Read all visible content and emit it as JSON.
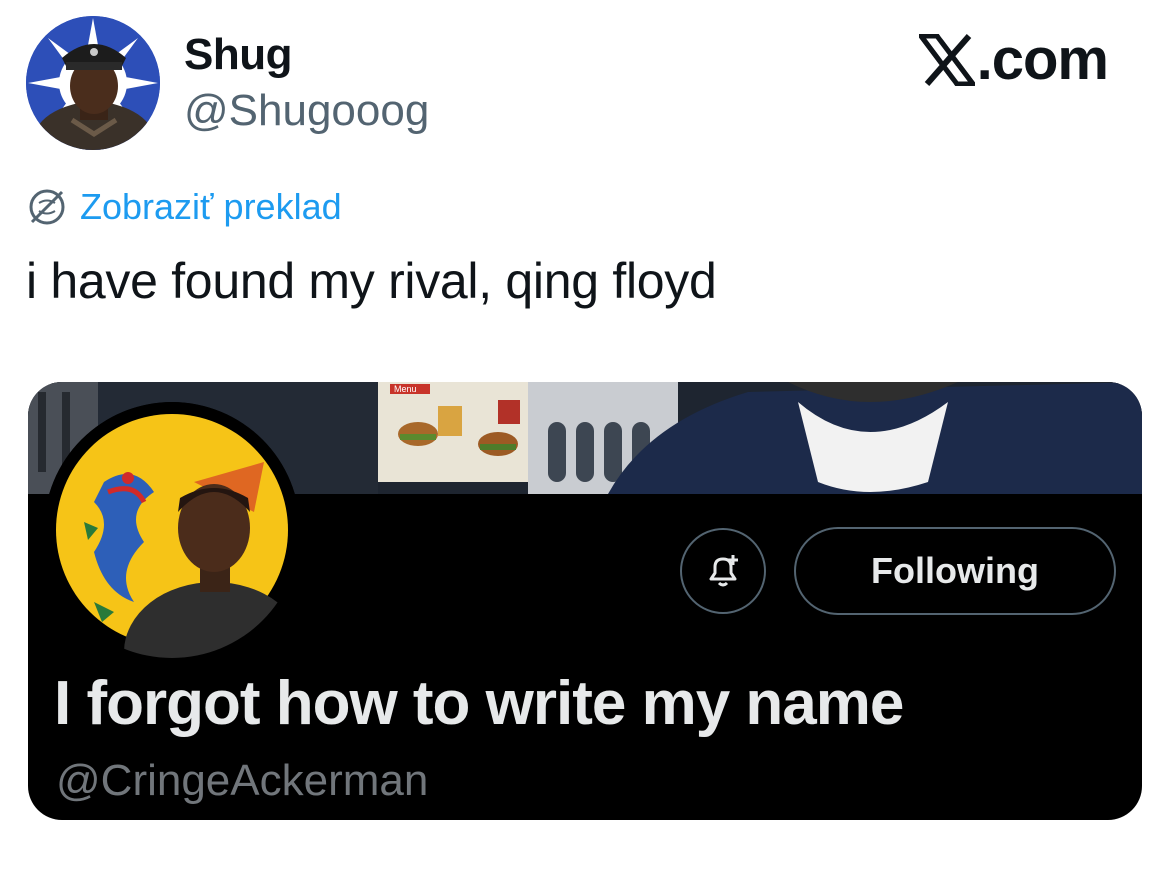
{
  "author": {
    "display_name": "Shug",
    "handle": "@Shugooog"
  },
  "site": {
    "logo_text": ".com",
    "logo_icon": "x-logo-icon"
  },
  "translate": {
    "label": "Zobraziť preklad",
    "icon": "globe-icon"
  },
  "tweet": {
    "text": "i have found my rival, qing floyd"
  },
  "card": {
    "display_name": "I forgot how to write my name",
    "handle": "@CringeAckerman",
    "follow_button_label": "Following",
    "notify_icon": "bell-plus-icon",
    "banner_sign_text": "Menu"
  },
  "colors": {
    "link": "#1d9bf0",
    "text": "#0f1419",
    "secondary": "#536471",
    "card_bg": "#000000",
    "card_text": "#e7e9ea",
    "card_secondary": "#71767b",
    "flag_yellow": "#f6c417",
    "flag_blue": "#2d4fb8"
  }
}
